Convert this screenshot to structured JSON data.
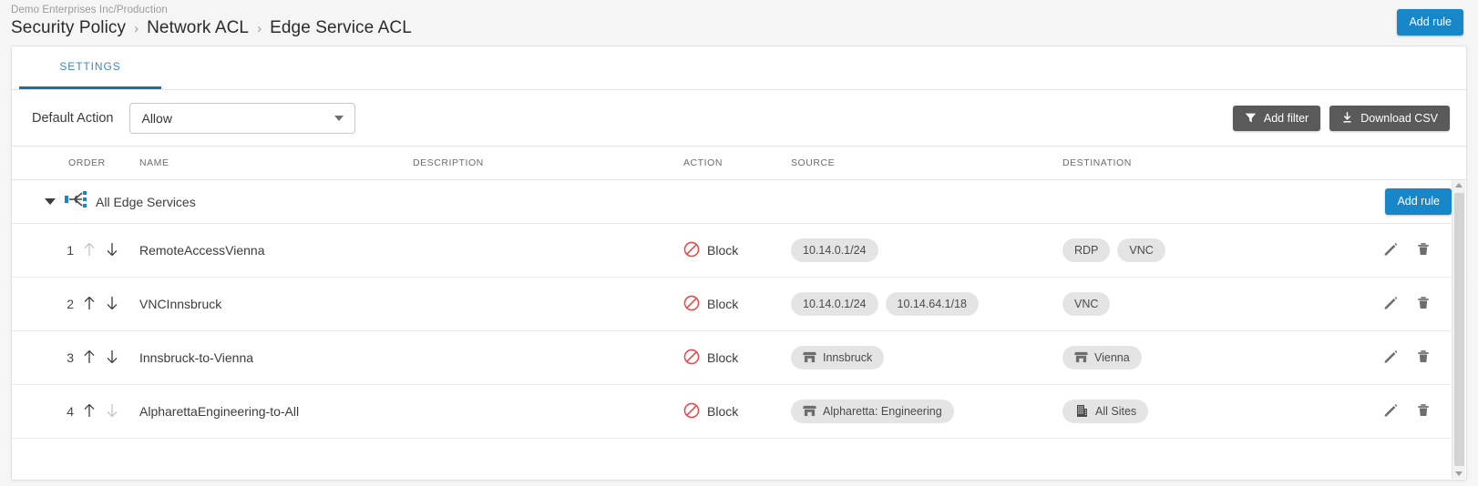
{
  "header": {
    "tenant_path": "Demo Enterprises Inc/Production",
    "breadcrumb": [
      "Security Policy",
      "Network ACL",
      "Edge Service ACL"
    ],
    "separator": "›",
    "add_rule_label": "Add rule"
  },
  "tabs": [
    {
      "label": "SETTINGS",
      "active": true
    }
  ],
  "toolbar": {
    "default_action_label": "Default Action",
    "default_action_value": "Allow",
    "add_filter_label": "Add filter",
    "download_csv_label": "Download CSV"
  },
  "table": {
    "columns": [
      "ORDER",
      "NAME",
      "DESCRIPTION",
      "ACTION",
      "SOURCE",
      "DESTINATION"
    ],
    "group": {
      "label": "All Edge Services",
      "icon": "service-branch-icon",
      "expanded": true,
      "add_rule_label": "Add rule"
    },
    "rows": [
      {
        "order": "1",
        "up_enabled": false,
        "down_enabled": true,
        "name": "RemoteAccessVienna",
        "description": "",
        "action": "Block",
        "source": [
          {
            "label": "10.14.0.1/24",
            "icon": ""
          }
        ],
        "destination": [
          {
            "label": "RDP",
            "icon": ""
          },
          {
            "label": "VNC",
            "icon": ""
          }
        ]
      },
      {
        "order": "2",
        "up_enabled": true,
        "down_enabled": true,
        "name": "VNCInnsbruck",
        "description": "",
        "action": "Block",
        "source": [
          {
            "label": "10.14.0.1/24",
            "icon": ""
          },
          {
            "label": "10.14.64.1/18",
            "icon": ""
          }
        ],
        "destination": [
          {
            "label": "VNC",
            "icon": ""
          }
        ]
      },
      {
        "order": "3",
        "up_enabled": true,
        "down_enabled": true,
        "name": "Innsbruck-to-Vienna",
        "description": "",
        "action": "Block",
        "source": [
          {
            "label": "Innsbruck",
            "icon": "site-icon"
          }
        ],
        "destination": [
          {
            "label": "Vienna",
            "icon": "site-icon"
          }
        ]
      },
      {
        "order": "4",
        "up_enabled": true,
        "down_enabled": false,
        "name": "AlpharettaEngineering-to-All",
        "description": "",
        "action": "Block",
        "source": [
          {
            "label": "Alpharetta: Engineering",
            "icon": "site-icon"
          }
        ],
        "destination": [
          {
            "label": "All Sites",
            "icon": "building-icon"
          }
        ]
      }
    ],
    "row_tools": {
      "edit_label": "Edit",
      "delete_label": "Delete"
    }
  },
  "colors": {
    "primary": "#1887c9",
    "dark_button": "#5a5a5a",
    "block_red": "#e8474c",
    "chip_bg": "#e4e4e4",
    "tab_active": "#1273a8"
  }
}
